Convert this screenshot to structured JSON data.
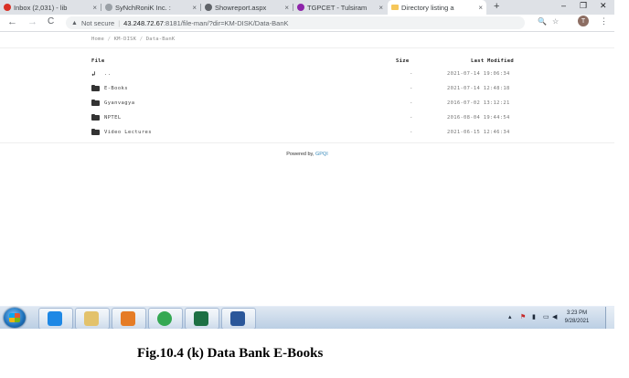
{
  "tabs": [
    {
      "title": "Inbox (2,031) - lib",
      "color": "#d93025"
    },
    {
      "title": "SyNchRoniK Inc. :",
      "color": "#9aa0a6"
    },
    {
      "title": "Showreport.aspx",
      "color": "#5f6368"
    },
    {
      "title": "TGPCET - Tulsiram",
      "color": "#8e24aa"
    },
    {
      "title": "Directory listing a",
      "color": "#f6c75a",
      "active": true
    }
  ],
  "close_glyph": "×",
  "newtab_glyph": "+",
  "window_controls": [
    "–",
    "❐",
    "✕"
  ],
  "toolbar": {
    "back_glyph": "←",
    "forward_glyph": "→",
    "reload_glyph": "C"
  },
  "address": {
    "security_label": "Not secure",
    "host": "43.248.72.67",
    "path": ":8181/file-man/?dir=KM-DISK/Data-BanK",
    "search_glyph": "🔍",
    "star_glyph": "☆"
  },
  "profile_initial": "T",
  "menu_glyph": "⋮",
  "breadcrumb": {
    "items": [
      "Home",
      "KM-DISK",
      "Data-BanK"
    ],
    "separator": "/"
  },
  "listing": {
    "headers": {
      "file": "File",
      "size": "Size",
      "modified": "Last Modified"
    },
    "rows": [
      {
        "icon": "up-dir",
        "name": "..",
        "size": "-",
        "modified": "2021-07-14 19:06:34"
      },
      {
        "icon": "folder",
        "name": "E-Books",
        "size": "-",
        "modified": "2021-07-14 12:48:18"
      },
      {
        "icon": "folder",
        "name": "Gyanvagya",
        "size": "-",
        "modified": "2016-07-02 13:12:21"
      },
      {
        "icon": "folder",
        "name": "NPTEL",
        "size": "-",
        "modified": "2016-08-04 19:44:54"
      },
      {
        "icon": "folder",
        "name": "Video Lectures",
        "size": "-",
        "modified": "2021-06-15 12:46:34"
      }
    ]
  },
  "footer": {
    "prefix": "Powered by",
    "link": "GPQI"
  },
  "taskbar": {
    "clock_time": "3:23 PM",
    "clock_date": "9/28/2021",
    "apps": [
      {
        "name": "internet-explorer",
        "color": "#1e88e5"
      },
      {
        "name": "file-explorer",
        "color": "#e3c26b"
      },
      {
        "name": "media-player",
        "color": "#e57c26"
      },
      {
        "name": "chrome",
        "color": "#34a853"
      },
      {
        "name": "excel",
        "color": "#1d7044"
      },
      {
        "name": "word",
        "color": "#2b579a"
      }
    ]
  },
  "caption": "Fig.10.4 (k) Data Bank E-Books"
}
